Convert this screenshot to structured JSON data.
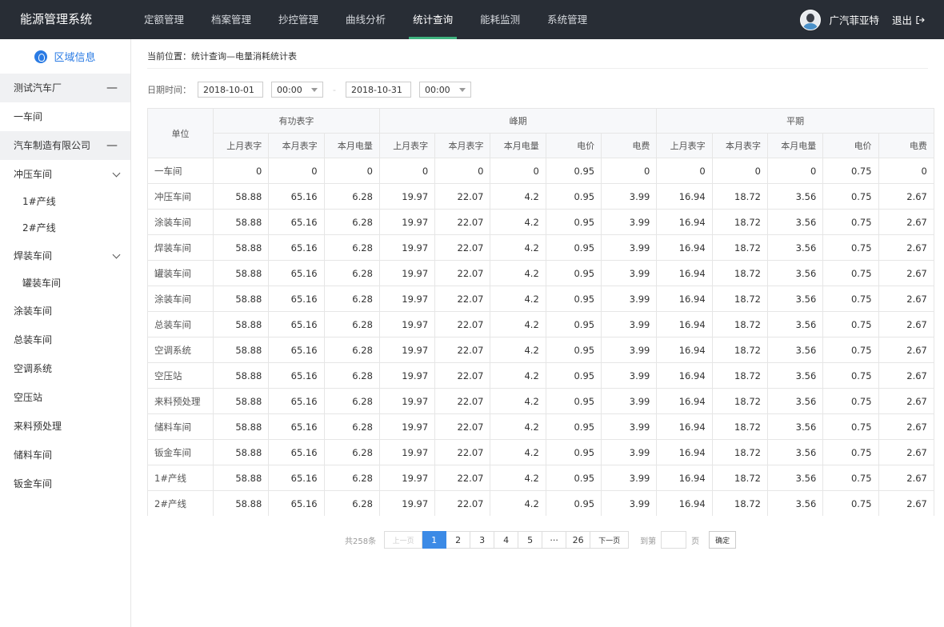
{
  "app_title": "能源管理系统",
  "nav": [
    "定额管理",
    "档案管理",
    "抄控管理",
    "曲线分析",
    "统计查询",
    "能耗监测",
    "系统管理"
  ],
  "nav_active": 4,
  "user": {
    "name": "广汽菲亚特",
    "logout": "退出"
  },
  "sidebar": {
    "title": "区域信息",
    "items": [
      {
        "label": "测试汽车厂",
        "kind": "group",
        "toggle": "—"
      },
      {
        "label": "一车间",
        "kind": "item"
      },
      {
        "label": "汽车制造有限公司",
        "kind": "group",
        "toggle": "—"
      },
      {
        "label": "冲压车间",
        "kind": "expand"
      },
      {
        "label": "1#产线",
        "kind": "sub"
      },
      {
        "label": "2#产线",
        "kind": "sub"
      },
      {
        "label": "焊装车间",
        "kind": "expand"
      },
      {
        "label": "罐装车间",
        "kind": "sub"
      },
      {
        "label": "涂装车间",
        "kind": "item"
      },
      {
        "label": "总装车间",
        "kind": "item"
      },
      {
        "label": "空调系统",
        "kind": "item"
      },
      {
        "label": "空压站",
        "kind": "item"
      },
      {
        "label": "来料预处理",
        "kind": "item"
      },
      {
        "label": "储料车间",
        "kind": "item"
      },
      {
        "label": "钣金车间",
        "kind": "item"
      }
    ]
  },
  "breadcrumb": "当前位置：统计查询—电量消耗统计表",
  "filter": {
    "label": "日期时间：",
    "start_date": "2018-10-01",
    "start_time": "00:00",
    "separator": "-",
    "end_date": "2018-10-31",
    "end_time": "00:00"
  },
  "table": {
    "unit_header": "单位",
    "groups": [
      {
        "label": "有功表字",
        "cols": [
          "上月表字",
          "本月表字",
          "本月电量"
        ]
      },
      {
        "label": "峰期",
        "cols": [
          "上月表字",
          "本月表字",
          "本月电量",
          "电价",
          "电费"
        ]
      },
      {
        "label": "平期",
        "cols": [
          "上月表字",
          "本月表字",
          "本月电量",
          "电价",
          "电费"
        ]
      }
    ],
    "rows": [
      {
        "unit": "一车间",
        "values": [
          "0",
          "0",
          "0",
          "0",
          "0",
          "0",
          "0.95",
          "0",
          "0",
          "0",
          "0",
          "0.75",
          "0"
        ]
      },
      {
        "unit": "冲压车间",
        "values": [
          "58.88",
          "65.16",
          "6.28",
          "19.97",
          "22.07",
          "4.2",
          "0.95",
          "3.99",
          "16.94",
          "18.72",
          "3.56",
          "0.75",
          "2.67"
        ]
      },
      {
        "unit": "涂装车间",
        "values": [
          "58.88",
          "65.16",
          "6.28",
          "19.97",
          "22.07",
          "4.2",
          "0.95",
          "3.99",
          "16.94",
          "18.72",
          "3.56",
          "0.75",
          "2.67"
        ]
      },
      {
        "unit": "焊装车间",
        "values": [
          "58.88",
          "65.16",
          "6.28",
          "19.97",
          "22.07",
          "4.2",
          "0.95",
          "3.99",
          "16.94",
          "18.72",
          "3.56",
          "0.75",
          "2.67"
        ]
      },
      {
        "unit": "罐装车间",
        "values": [
          "58.88",
          "65.16",
          "6.28",
          "19.97",
          "22.07",
          "4.2",
          "0.95",
          "3.99",
          "16.94",
          "18.72",
          "3.56",
          "0.75",
          "2.67"
        ]
      },
      {
        "unit": "涂装车间",
        "values": [
          "58.88",
          "65.16",
          "6.28",
          "19.97",
          "22.07",
          "4.2",
          "0.95",
          "3.99",
          "16.94",
          "18.72",
          "3.56",
          "0.75",
          "2.67"
        ]
      },
      {
        "unit": "总装车间",
        "values": [
          "58.88",
          "65.16",
          "6.28",
          "19.97",
          "22.07",
          "4.2",
          "0.95",
          "3.99",
          "16.94",
          "18.72",
          "3.56",
          "0.75",
          "2.67"
        ]
      },
      {
        "unit": "空调系统",
        "values": [
          "58.88",
          "65.16",
          "6.28",
          "19.97",
          "22.07",
          "4.2",
          "0.95",
          "3.99",
          "16.94",
          "18.72",
          "3.56",
          "0.75",
          "2.67"
        ]
      },
      {
        "unit": "空压站",
        "values": [
          "58.88",
          "65.16",
          "6.28",
          "19.97",
          "22.07",
          "4.2",
          "0.95",
          "3.99",
          "16.94",
          "18.72",
          "3.56",
          "0.75",
          "2.67"
        ]
      },
      {
        "unit": "来料预处理",
        "values": [
          "58.88",
          "65.16",
          "6.28",
          "19.97",
          "22.07",
          "4.2",
          "0.95",
          "3.99",
          "16.94",
          "18.72",
          "3.56",
          "0.75",
          "2.67"
        ]
      },
      {
        "unit": "储料车间",
        "values": [
          "58.88",
          "65.16",
          "6.28",
          "19.97",
          "22.07",
          "4.2",
          "0.95",
          "3.99",
          "16.94",
          "18.72",
          "3.56",
          "0.75",
          "2.67"
        ]
      },
      {
        "unit": "钣金车间",
        "values": [
          "58.88",
          "65.16",
          "6.28",
          "19.97",
          "22.07",
          "4.2",
          "0.95",
          "3.99",
          "16.94",
          "18.72",
          "3.56",
          "0.75",
          "2.67"
        ]
      },
      {
        "unit": "1#产线",
        "values": [
          "58.88",
          "65.16",
          "6.28",
          "19.97",
          "22.07",
          "4.2",
          "0.95",
          "3.99",
          "16.94",
          "18.72",
          "3.56",
          "0.75",
          "2.67"
        ]
      },
      {
        "unit": "2#产线",
        "values": [
          "58.88",
          "65.16",
          "6.28",
          "19.97",
          "22.07",
          "4.2",
          "0.95",
          "3.99",
          "16.94",
          "18.72",
          "3.56",
          "0.75",
          "2.67"
        ]
      }
    ]
  },
  "pagination": {
    "total": "共258条",
    "prev": "上一页",
    "pages": [
      "1",
      "2",
      "3",
      "4",
      "5",
      "···",
      "26"
    ],
    "active": 0,
    "next": "下一页",
    "goto_label": "到第",
    "page_unit": "页",
    "confirm": "确定"
  },
  "colors": {
    "topbar": "#282d35",
    "nav_underline": "#3fb37f",
    "accent": "#2a7be4",
    "active_page": "#3b8ae6"
  }
}
